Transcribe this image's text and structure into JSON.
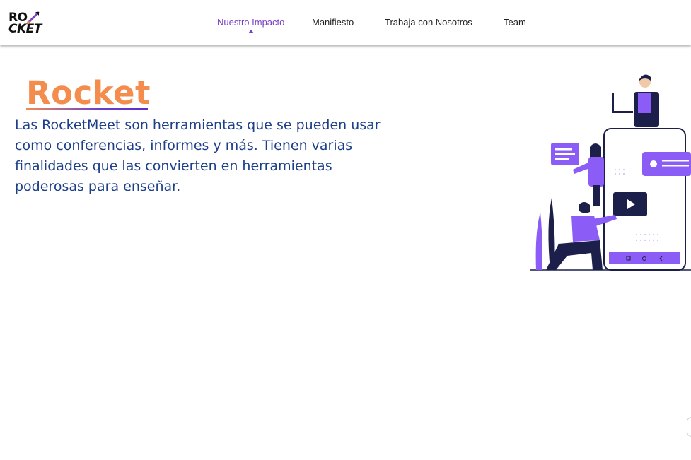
{
  "brand": {
    "logo_line1": "RO",
    "logo_line2": "CKET"
  },
  "nav": {
    "items": [
      {
        "label": "Nuestro Impacto",
        "active": true
      },
      {
        "label": "Manifiesto",
        "active": false
      },
      {
        "label": "Trabaja con Nosotros",
        "active": false
      },
      {
        "label": "Team",
        "active": false
      }
    ]
  },
  "hero": {
    "title": "Rocket",
    "description": "Las RocketMeet son herramientas que se pueden usar como conferencias, informes y más. Tienen varias finalidades que las convierten en herramientas poderosas para enseñar."
  },
  "colors": {
    "accent": "#7b3fc8",
    "title_orange": "#f48c4d",
    "text_blue": "#1d3f8a",
    "illustration_purple": "#8b5cf6",
    "illustration_navy": "#1b1f4a"
  },
  "icons": [
    "rocket-icon",
    "play-icon",
    "laptop-icon",
    "chat-bubble-icon"
  ]
}
